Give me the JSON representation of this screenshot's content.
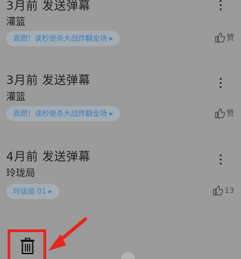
{
  "comments": [
    {
      "time_action": "3月前 发送弹幕",
      "name": "灌篮",
      "tag": "高燃！读秒绝杀大战炸翻全场 ▸",
      "likes": "赞"
    },
    {
      "time_action": "3月前 发送弹幕",
      "name": "灌篮",
      "tag": "高燃！读秒绝杀大战炸翻全场 ▸",
      "likes": "赞"
    },
    {
      "time_action": "4月前 发送弹幕",
      "name": "玲珑局",
      "tag": "玲珑局 01 ▸",
      "likes": "13"
    }
  ],
  "icons": {
    "more": "more-vertical-icon",
    "like": "thumbs-up-icon",
    "delete": "trash-icon"
  },
  "colors": {
    "background": "#9b9b9b",
    "tag_text": "#3d7fbd",
    "highlight": "#e8261e"
  }
}
